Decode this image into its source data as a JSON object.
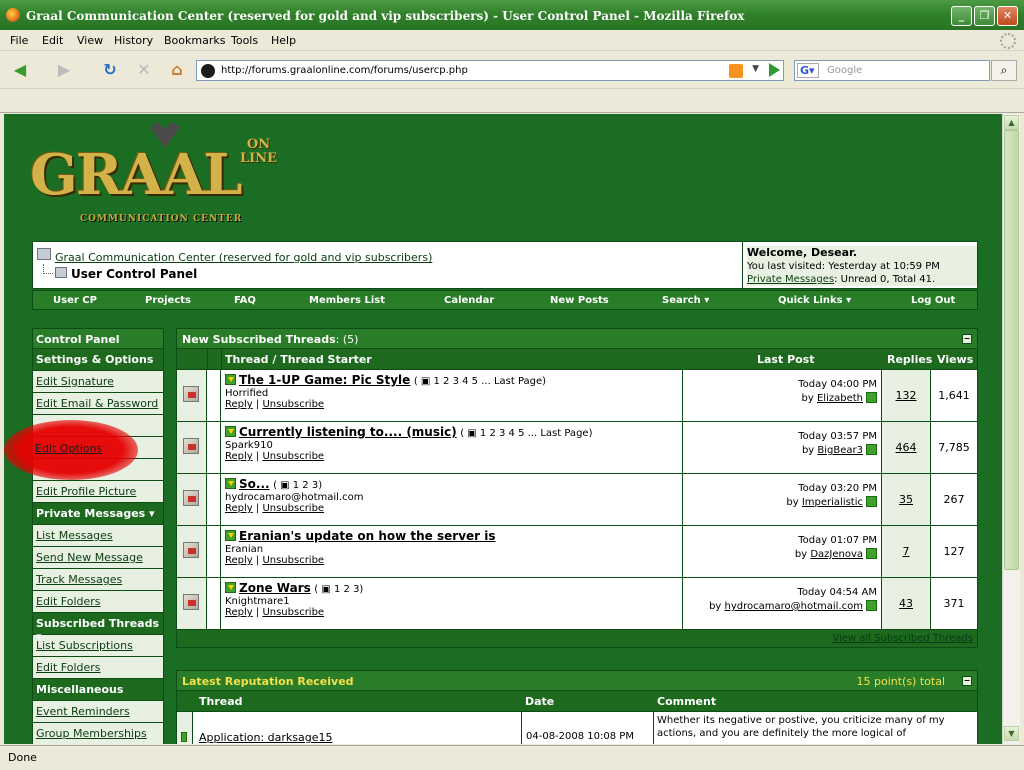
{
  "window": {
    "title": "Graal Communication Center (reserved for gold and vip subscribers) - User Control Panel - Mozilla Firefox"
  },
  "menu": [
    "File",
    "Edit",
    "View",
    "History",
    "Bookmarks",
    "Tools",
    "Help"
  ],
  "address": {
    "url": "http://forums.graalonline.com/forums/usercp.php",
    "search_placeholder": "Google"
  },
  "status": "Done",
  "logo": {
    "main": "GRAAL",
    "on": "ON",
    "line": "LINE",
    "subtitle": "COMMUNICATION CENTER"
  },
  "breadcrumb": {
    "forum_link": "Graal Communication Center (reserved for gold and vip subscribers)",
    "current": "User Control Panel"
  },
  "welcome": {
    "greeting": "Welcome, Desear.",
    "last_visit": "You last visited: Yesterday at 10:59 PM",
    "pm_link": "Private Messages",
    "pm_status": ": Unread 0, Total 41."
  },
  "topnav": [
    "User CP",
    "Projects",
    "FAQ",
    "Members List",
    "Calendar",
    "New Posts",
    "Search ▾",
    "Quick Links ▾",
    "Log Out"
  ],
  "control_panel": {
    "title": "Control Panel",
    "settings_header": "Settings & Options",
    "edit_signature": "Edit Signature",
    "edit_email": "Edit Email & Password",
    "edit_options": "Edit Options",
    "edit_profile_picture": "Edit Profile Picture",
    "pm_header": "Private Messages ▾",
    "list_messages": "List Messages",
    "send_message": "Send New Message",
    "track_messages": "Track Messages",
    "edit_folders": "Edit Folders",
    "subs_header": "Subscribed Threads ▾",
    "list_subscriptions": "List Subscriptions",
    "edit_folders2": "Edit Folders",
    "misc_header": "Miscellaneous",
    "event_reminders": "Event Reminders",
    "group_memberships": "Group Memberships"
  },
  "threads": {
    "title": "New Subscribed Threads",
    "count": ": (5)",
    "col_thread": "Thread / Thread Starter",
    "col_last": "Last Post",
    "col_replies": "Replies",
    "col_views": "Views",
    "reply": "Reply",
    "unsubscribe": "Unsubscribe",
    "view_all": "View all Subscribed Threads",
    "rows": [
      {
        "title": "The 1-UP Game: Pic Style",
        "pages": "( ▣ 1 2 3 4 5 ... Last Page)",
        "starter": "Horrified",
        "date": "Today 04:00 PM",
        "by": "Elizabeth",
        "replies": "132",
        "views": "1,641"
      },
      {
        "title": "Currently listening to.... (music)",
        "pages": "( ▣ 1 2 3 4 5 ... Last Page)",
        "starter": "Spark910",
        "date": "Today 03:57 PM",
        "by": "BigBear3",
        "replies": "464",
        "views": "7,785"
      },
      {
        "title": "So...",
        "pages": "( ▣ 1 2 3)",
        "starter": "hydrocamaro@hotmail.com",
        "date": "Today 03:20 PM",
        "by": "Imperialistic",
        "replies": "35",
        "views": "267"
      },
      {
        "title": "Eranian's update on how the server is",
        "pages": "",
        "starter": "Eranian",
        "date": "Today 01:07 PM",
        "by": "DazJenova",
        "replies": "7",
        "views": "127"
      },
      {
        "title": "Zone Wars",
        "pages": "( ▣ 1 2 3)",
        "starter": "Knightmare1",
        "date": "Today 04:54 AM",
        "by": "hydrocamaro@hotmail.com",
        "replies": "43",
        "views": "371"
      }
    ]
  },
  "reputation": {
    "title": "Latest Reputation Received",
    "total": "15 point(s) total",
    "col_thread": "Thread",
    "col_date": "Date",
    "col_comment": "Comment",
    "row": {
      "thread": "Application: darksage15",
      "date": "04-08-2008 10:08 PM",
      "comment": "Whether its negative or postive, you criticize many of my actions, and you are definitely the more logical of"
    }
  }
}
